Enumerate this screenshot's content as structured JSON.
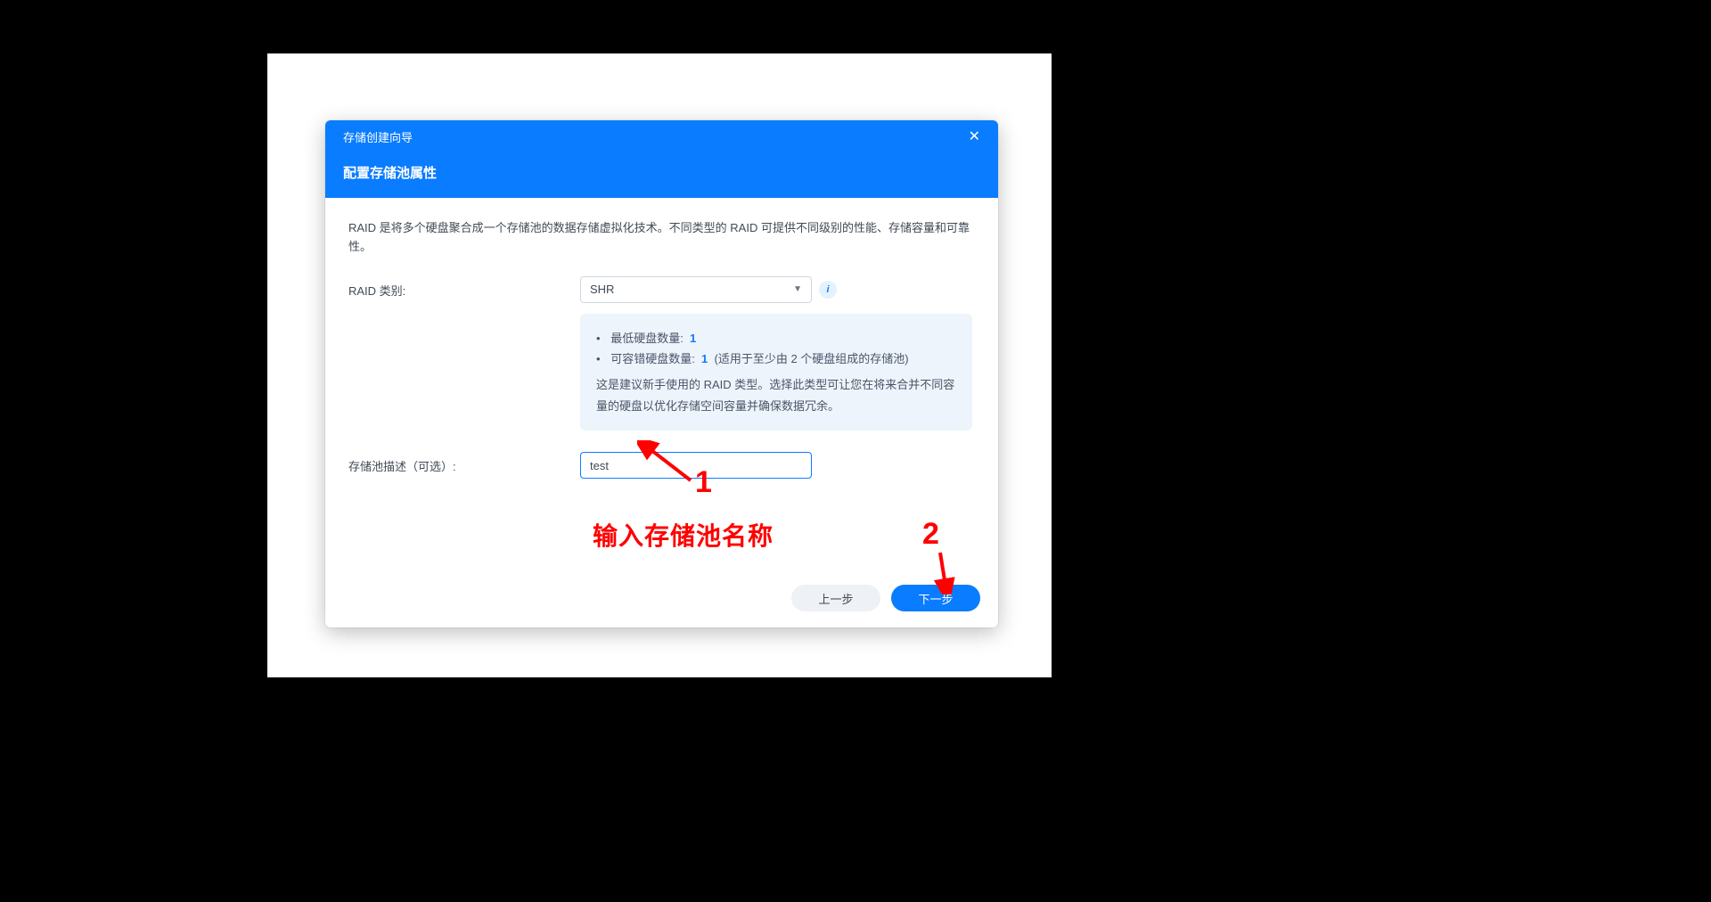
{
  "modal": {
    "title": "存储创建向导",
    "subtitle": "配置存储池属性",
    "intro": "RAID 是将多个硬盘聚合成一个存储池的数据存储虚拟化技术。不同类型的 RAID 可提供不同级别的性能、存储容量和可靠性。",
    "raid_label": "RAID 类别:",
    "raid_selected": "SHR",
    "info": {
      "min_disks_label": "最低硬盘数量:",
      "min_disks_value": "1",
      "tolerable_label": "可容错硬盘数量:",
      "tolerable_value": "1",
      "tolerable_note": "(适用于至少由 2 个硬盘组成的存储池)",
      "description": "这是建议新手使用的 RAID 类型。选择此类型可让您在将来合并不同容量的硬盘以优化存储空间容量并确保数据冗余。"
    },
    "desc_label": "存储池描述（可选）:",
    "desc_value": "test",
    "buttons": {
      "prev": "上一步",
      "next": "下一步"
    }
  },
  "annotations": {
    "num1": "1",
    "num2": "2",
    "label1": "输入存储池名称"
  }
}
